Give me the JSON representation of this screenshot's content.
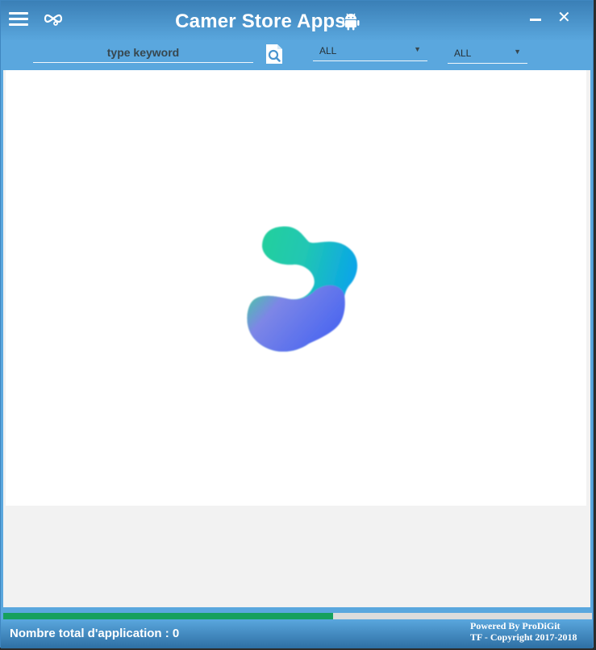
{
  "window": {
    "title": "Camer Store Apps",
    "icons": {
      "menu": "hamburger-menu-icon",
      "logo": "infinity-logo-icon",
      "android": "android-icon",
      "minimize": "minimize-icon",
      "close": "close-icon"
    },
    "close_glyph": "✕"
  },
  "toolbar": {
    "search_placeholder": "type keyword",
    "search_value": "",
    "search_icon": "search-icon",
    "filter1": {
      "selected": "ALL"
    },
    "filter2": {
      "selected": "ALL"
    },
    "caret_glyph": "▼"
  },
  "main": {
    "loading_icon": "loading-blob-icon"
  },
  "progress": {
    "value": 0.56,
    "color": "#16a05d"
  },
  "footer": {
    "total_label": "Nombre total d'application : 0",
    "credit_line1": "Powered By ProDiGit",
    "credit_line2": "TF - Copyright 2017-2018"
  },
  "colors": {
    "accent": "#5aa7de",
    "panel": "#ffffff",
    "background": "#f2f2f2"
  }
}
